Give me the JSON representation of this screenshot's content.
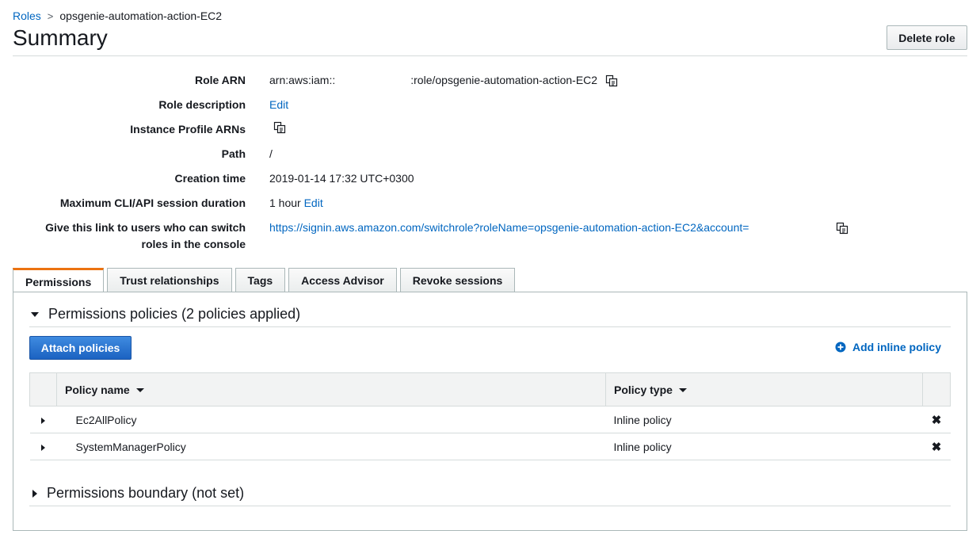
{
  "breadcrumb": {
    "parent": "Roles",
    "separator": ">",
    "current": "opsgenie-automation-action-EC2"
  },
  "header": {
    "title": "Summary",
    "delete_label": "Delete role"
  },
  "summary": {
    "role_arn_label": "Role ARN",
    "role_arn_prefix": "arn:aws:iam::",
    "role_arn_suffix": ":role/opsgenie-automation-action-EC2",
    "role_description_label": "Role description",
    "role_description_edit": "Edit",
    "instance_profile_label": "Instance Profile ARNs",
    "path_label": "Path",
    "path_value": "/",
    "creation_time_label": "Creation time",
    "creation_time_value": "2019-01-14 17:32 UTC+0300",
    "max_session_label": "Maximum CLI/API session duration",
    "max_session_value": "1 hour",
    "max_session_edit": "Edit",
    "switch_link_label_1": "Give this link to users who can switch",
    "switch_link_label_2": "roles in the console",
    "switch_link_value": "https://signin.aws.amazon.com/switchrole?roleName=opsgenie-automation-action-EC2&account="
  },
  "tabs": [
    {
      "label": "Permissions",
      "active": true
    },
    {
      "label": "Trust relationships"
    },
    {
      "label": "Tags"
    },
    {
      "label": "Access Advisor"
    },
    {
      "label": "Revoke sessions"
    }
  ],
  "permissions": {
    "policies_heading": "Permissions policies (2 policies applied)",
    "attach_label": "Attach policies",
    "add_inline_label": "Add inline policy",
    "columns": {
      "name": "Policy name",
      "type": "Policy type"
    },
    "rows": [
      {
        "name": "Ec2AllPolicy",
        "type": "Inline policy"
      },
      {
        "name": "SystemManagerPolicy",
        "type": "Inline policy"
      }
    ],
    "boundary_heading": "Permissions boundary (not set)"
  },
  "icons": {
    "copy": "copy-icon",
    "remove": "x-icon",
    "add": "plus-circle-icon"
  },
  "colors": {
    "link": "#0066c0",
    "accent": "#ec7211",
    "primary_button": "#1b62c1"
  }
}
